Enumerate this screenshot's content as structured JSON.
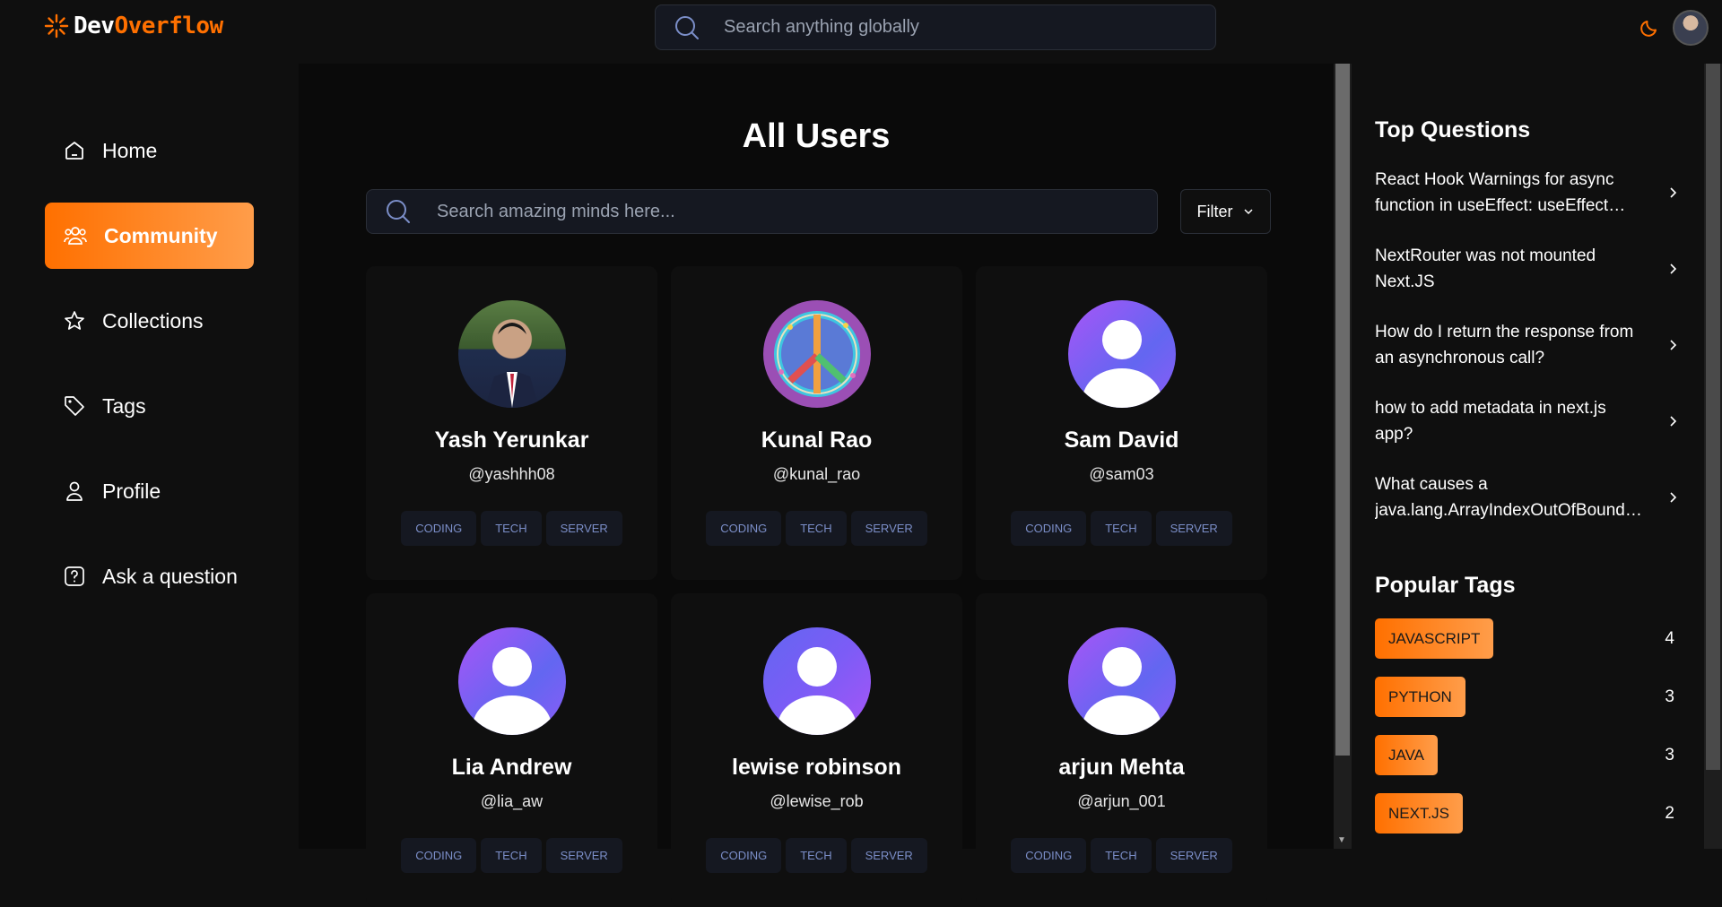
{
  "app": {
    "logo_prefix": "Dev",
    "logo_suffix": "Overflow"
  },
  "header": {
    "search_placeholder": "Search anything globally"
  },
  "sidebar": {
    "items": [
      {
        "label": "Home",
        "icon": "home-icon"
      },
      {
        "label": "Community",
        "icon": "users-icon",
        "active": true
      },
      {
        "label": "Collections",
        "icon": "star-icon"
      },
      {
        "label": "Tags",
        "icon": "tag-icon"
      },
      {
        "label": "Profile",
        "icon": "user-icon"
      },
      {
        "label": "Ask a question",
        "icon": "question-icon"
      }
    ]
  },
  "main": {
    "title": "All Users",
    "search_placeholder": "Search amazing minds here...",
    "filter_label": "Filter",
    "users": [
      {
        "name": "Yash Yerunkar",
        "handle": "@yashhh08",
        "avatar": "photo"
      },
      {
        "name": "Kunal Rao",
        "handle": "@kunal_rao",
        "avatar": "peace"
      },
      {
        "name": "Sam David",
        "handle": "@sam03",
        "avatar": "default"
      },
      {
        "name": "Lia Andrew",
        "handle": "@lia_aw",
        "avatar": "default"
      },
      {
        "name": "lewise robinson",
        "handle": "@lewise_rob",
        "avatar": "default"
      },
      {
        "name": "arjun Mehta",
        "handle": "@arjun_001",
        "avatar": "default"
      }
    ],
    "card_tags": [
      "CODING",
      "TECH",
      "SERVER"
    ]
  },
  "rightbar": {
    "top_questions_title": "Top Questions",
    "questions": [
      "React Hook Warnings for async function in useEffect: useEffect function must return a cleanup function or nothing",
      "NextRouter was not mounted Next.JS",
      "How do I return the response from an asynchronous call?",
      "how to add metadata in next.js app?",
      "What causes a java.lang.ArrayIndexOutOfBoundsException and how do I prevent it?"
    ],
    "popular_tags_title": "Popular Tags",
    "tags": [
      {
        "name": "JAVASCRIPT",
        "count": "4"
      },
      {
        "name": "PYTHON",
        "count": "3"
      },
      {
        "name": "JAVA",
        "count": "3"
      },
      {
        "name": "NEXT.JS",
        "count": "2"
      }
    ]
  },
  "colors": {
    "accent": "#ff7000",
    "background": "#0f0f0f",
    "card": "#0f0f0f",
    "tag_text": "#7b8ec8"
  }
}
